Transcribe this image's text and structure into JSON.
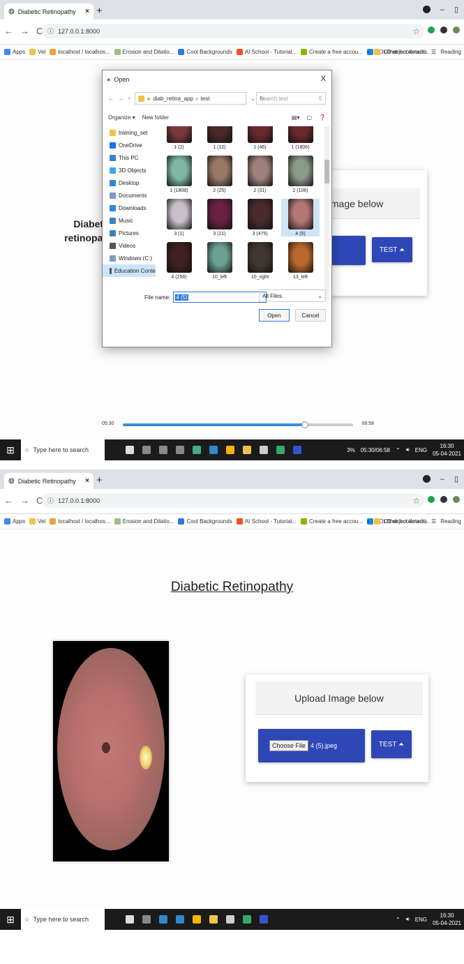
{
  "browser": {
    "tab_title": "Diabetic Retinopathy",
    "tab_close": "×",
    "new_tab": "+",
    "url": "127.0.0.1:8000",
    "bookmarks": [
      "Apps",
      "Vel",
      "localhost / localhos...",
      "Erosion and Dilatio...",
      "Cool Backgrounds",
      "AI School - Tutorial...",
      "Create a free accou...",
      "YOLO object detecti..."
    ],
    "bookmarks_more": "»",
    "other_bookmarks": "Other bookmarks",
    "reading": "Reading"
  },
  "frame1": {
    "side_text_1": "Diabeti",
    "side_text_2": "retinopat",
    "card_header": "Image below",
    "test_button": "TEST",
    "dialog": {
      "title": "Open",
      "close": "X",
      "path": [
        "diab_retina_app",
        "test"
      ],
      "path_prefix": "«",
      "search_placeholder": "Search test",
      "organize": "Organize ▾",
      "new_folder": "New folder",
      "nav": [
        {
          "label": "training_set",
          "color": "#f0c14b"
        },
        {
          "label": "OneDrive",
          "color": "#1a73e8"
        },
        {
          "label": "This PC",
          "color": "#3b83c4"
        },
        {
          "label": "3D Objects",
          "color": "#41a5ee"
        },
        {
          "label": "Desktop",
          "color": "#2b88d8"
        },
        {
          "label": "Documents",
          "color": "#7a9cc6"
        },
        {
          "label": "Downloads",
          "color": "#2b88d8"
        },
        {
          "label": "Music",
          "color": "#3b83c4"
        },
        {
          "label": "Pictures",
          "color": "#3b83c4"
        },
        {
          "label": "Videos",
          "color": "#555555"
        },
        {
          "label": "Windows (C:)",
          "color": "#7a9cc6"
        },
        {
          "label": "Education Conte",
          "color": "#555555"
        }
      ],
      "files": [
        {
          "label": "1 (2)",
          "color": "#7a3a3a"
        },
        {
          "label": "1 (12)",
          "color": "#4a2a2a"
        },
        {
          "label": "1 (46)",
          "color": "#6a2a30"
        },
        {
          "label": "1 (1806)",
          "color": "#6a2a2a"
        },
        {
          "label": "1 (1808)",
          "color": "#7fb7a4"
        },
        {
          "label": "2 (25)",
          "color": "#9a7866"
        },
        {
          "label": "2 (31)",
          "color": "#a0807a"
        },
        {
          "label": "2 (106)",
          "color": "#8a9a88"
        },
        {
          "label": "3 (1)",
          "color": "#c8c0c8"
        },
        {
          "label": "3 (21)",
          "color": "#6a2040"
        },
        {
          "label": "3 (475)",
          "color": "#4a2a2a"
        },
        {
          "label": "4 (5)",
          "color": "#b67676"
        },
        {
          "label": "4 (256)",
          "color": "#402020"
        },
        {
          "label": "10_left",
          "color": "#6aa090"
        },
        {
          "label": "10_right",
          "color": "#403830"
        },
        {
          "label": "13_left",
          "color": "#b8682a"
        }
      ],
      "file_name_label": "File name:",
      "file_name_value": "4 (5)",
      "file_type": "All Files",
      "open_button": "Open",
      "cancel_button": "Cancel"
    },
    "player": {
      "elapsed": "05:30",
      "total": "06:58",
      "progress": 0.79
    }
  },
  "taskbar": {
    "search_placeholder": "Type here to search",
    "time": "16:30",
    "date": "05-04-2021",
    "lang": "ENG",
    "zoom": "3%",
    "timer": "05:30/06:58"
  },
  "frame2": {
    "page_title": "Diabetic Retinopathy",
    "card_header": "Upload Image below",
    "choose_file": "Choose File",
    "file_chosen": "4 (5).jpeg",
    "test_button": "TEST"
  }
}
